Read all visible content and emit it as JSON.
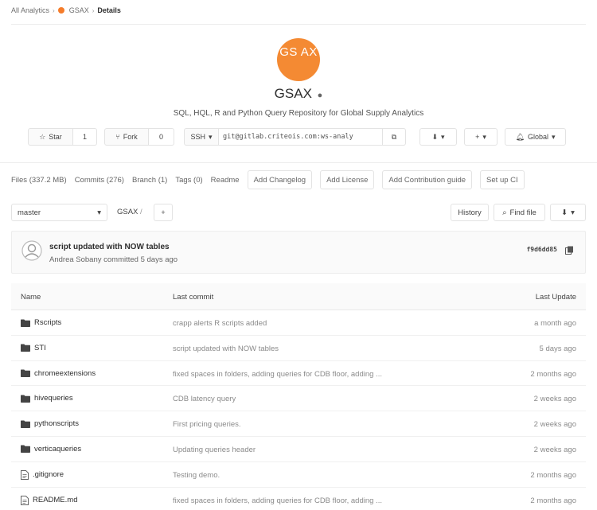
{
  "breadcrumb": {
    "group": "All Analytics",
    "project": "GSAX",
    "current": "Details"
  },
  "project": {
    "avatar_text": "GS AX",
    "name": "GSAX",
    "visibility_icon": "globe-icon",
    "description": "SQL, HQL, R and Python Query Repository for Global Supply Analytics"
  },
  "actions": {
    "star_label": "Star",
    "star_count": "1",
    "fork_label": "Fork",
    "fork_count": "0",
    "protocol": "SSH",
    "clone_url": "git@gitlab.criteois.com:ws-analy",
    "notification_label": "Global"
  },
  "stats": {
    "files": "Files (337.2 MB)",
    "commits": "Commits (276)",
    "branch": "Branch (1)",
    "tags": "Tags (0)",
    "readme": "Readme",
    "add_changelog": "Add Changelog",
    "add_license": "Add License",
    "add_contribution": "Add Contribution guide",
    "setup_ci": "Set up CI"
  },
  "repo": {
    "branch": "master",
    "path": "GSAX",
    "history_label": "History",
    "find_file_label": "Find file"
  },
  "last_commit": {
    "title": "script updated with NOW tables",
    "meta": "Andrea Sobany committed 5 days ago",
    "sha": "f9d6dd85"
  },
  "table": {
    "headers": {
      "name": "Name",
      "last_commit": "Last commit",
      "last_update": "Last Update"
    },
    "rows": [
      {
        "name": "Rscripts",
        "type": "folder",
        "commit": "crapp alerts R scripts added",
        "date": "a month ago"
      },
      {
        "name": "STI",
        "type": "folder",
        "commit": "script updated with NOW tables",
        "date": "5 days ago"
      },
      {
        "name": "chromeextensions",
        "type": "folder",
        "commit": "fixed spaces in folders, adding queries for CDB floor, adding ...",
        "date": "2 months ago"
      },
      {
        "name": "hivequeries",
        "type": "folder",
        "commit": "CDB latency query",
        "date": "2 weeks ago"
      },
      {
        "name": "pythonscripts",
        "type": "folder",
        "commit": "First pricing queries.",
        "date": "2 weeks ago"
      },
      {
        "name": "verticaqueries",
        "type": "folder",
        "commit": "Updating queries header",
        "date": "2 weeks ago"
      },
      {
        "name": ".gitignore",
        "type": "file",
        "commit": "Testing demo.",
        "date": "2 months ago"
      },
      {
        "name": "README.md",
        "type": "file",
        "commit": "fixed spaces in folders, adding queries for CDB floor, adding ...",
        "date": "2 months ago"
      }
    ]
  },
  "colors": {
    "avatar": "#f48a33",
    "border": "#e3e3e3",
    "muted": "#8a8a8a"
  }
}
